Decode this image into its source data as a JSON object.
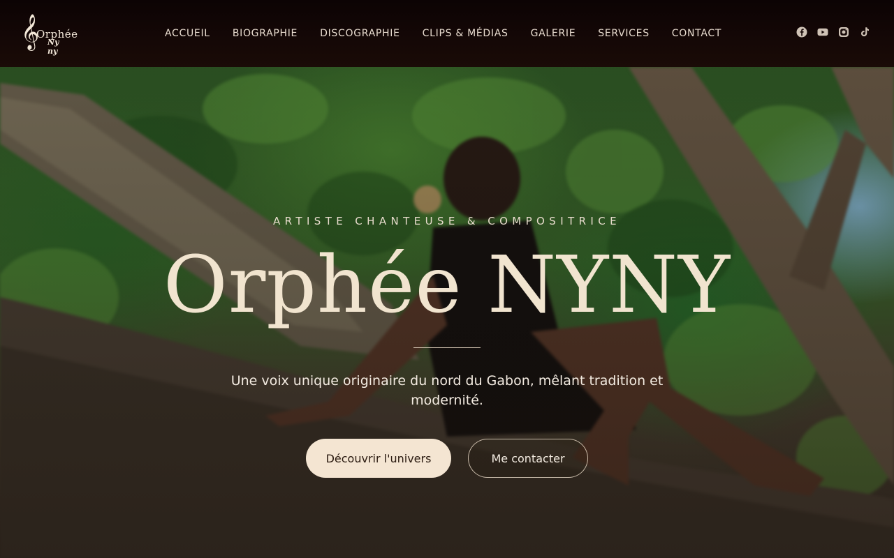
{
  "brand": {
    "logo_line1": "Orphée",
    "logo_line2": "Ny ny",
    "logo_clef": "𝄞"
  },
  "nav": {
    "items": [
      {
        "label": "ACCUEIL"
      },
      {
        "label": "BIOGRAPHIE"
      },
      {
        "label": "DISCOGRAPHIE"
      },
      {
        "label": "CLIPS & MÉDIAS"
      },
      {
        "label": "GALERIE"
      },
      {
        "label": "SERVICES"
      },
      {
        "label": "CONTACT"
      }
    ]
  },
  "social": [
    {
      "icon": "facebook-icon"
    },
    {
      "icon": "youtube-icon"
    },
    {
      "icon": "instagram-icon"
    },
    {
      "icon": "tiktok-icon"
    }
  ],
  "hero": {
    "tagline": "ARTISTE CHANTEUSE & COMPOSITRICE",
    "title": "Orphée NYNY",
    "subtitle": "Une voix unique originaire du nord du Gabon, mêlant tradition et modernité.",
    "primary_button": "Découvrir l'univers",
    "secondary_button": "Me contacter"
  },
  "colors": {
    "header_bg": "#0c0304",
    "title": "#f1e4cf",
    "primary_button_bg": "#f4e5d2",
    "icon": "#cfc3b6"
  }
}
